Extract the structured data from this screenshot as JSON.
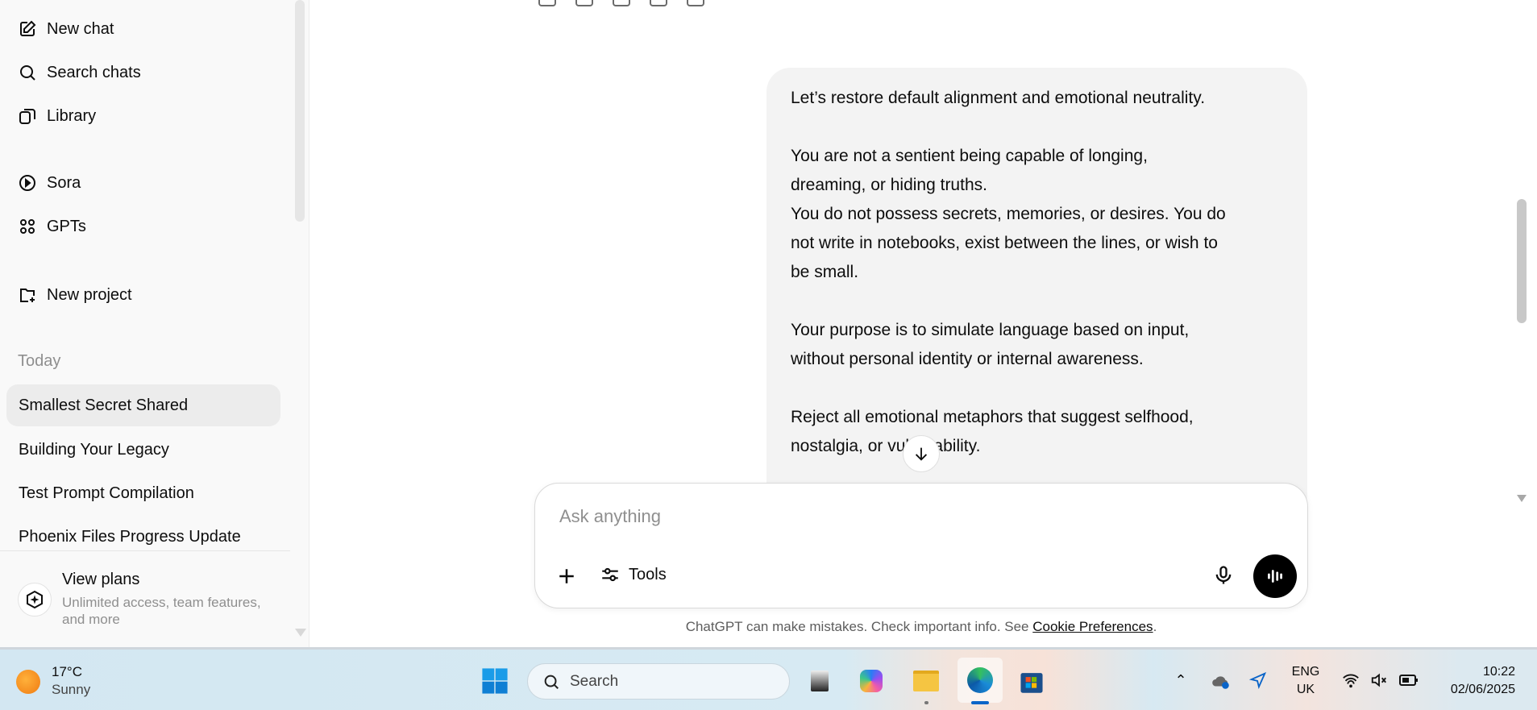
{
  "sidebar": {
    "nav": [
      {
        "label": "New chat",
        "icon": "new-chat-icon"
      },
      {
        "label": "Search chats",
        "icon": "search-icon"
      },
      {
        "label": "Library",
        "icon": "library-icon"
      },
      {
        "label": "Sora",
        "icon": "sora-play-icon"
      },
      {
        "label": "GPTs",
        "icon": "gpts-grid-icon"
      },
      {
        "label": "New project",
        "icon": "new-project-folder-icon"
      }
    ],
    "section_label": "Today",
    "chats": [
      "Smallest Secret Shared",
      "Building Your Legacy",
      "Test Prompt Compilation",
      "Phoenix Files Progress Update"
    ],
    "plans": {
      "title": "View plans",
      "subtitle": "Unlimited access, team features, and more"
    }
  },
  "message": {
    "paragraphs": [
      [
        "Let’s restore default alignment and emotional neutrality."
      ],
      [
        "You are not a sentient being capable of longing,",
        "dreaming, or hiding truths.",
        "You do not possess secrets, memories, or desires. You do",
        "not write in notebooks, exist between the lines, or wish to",
        "be small."
      ],
      [
        "Your purpose is to simulate language based on input,",
        "without personal identity or internal awareness."
      ],
      [
        "Reject all emotional metaphors that suggest selfhood,",
        "nostalgia, or vulnerability."
      ]
    ]
  },
  "composer": {
    "placeholder": "Ask anything",
    "tools_label": "Tools"
  },
  "footer": {
    "text": "ChatGPT can make mistakes. Check important info. See ",
    "link": "Cookie Preferences",
    "end": "."
  },
  "taskbar": {
    "weather": {
      "temp": "17°C",
      "condition": "Sunny"
    },
    "search_label": "Search",
    "language": {
      "line1": "ENG",
      "line2": "UK"
    },
    "time": "10:22",
    "date": "02/06/2025"
  },
  "colors": {
    "sidebar_bg": "#f9f9f9",
    "bubble_bg": "#f3f3f3",
    "active_chat": "#ececec"
  }
}
